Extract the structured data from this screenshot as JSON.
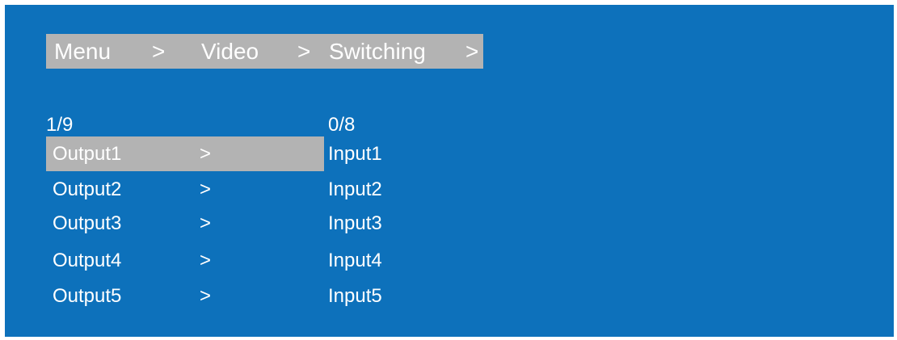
{
  "breadcrumb": {
    "menu": "Menu",
    "sep1": ">",
    "video": "Video",
    "sep2": ">",
    "switching": "Switching",
    "sep3": ">"
  },
  "outputs_page": "1/9",
  "inputs_page": "0/8",
  "rows": [
    {
      "output": "Output1",
      "arrow": ">",
      "input": "Input1",
      "selected": true
    },
    {
      "output": "Output2",
      "arrow": ">",
      "input": "Input2",
      "selected": false
    },
    {
      "output": "Output3",
      "arrow": ">",
      "input": "Input3",
      "selected": false
    },
    {
      "output": "Output4",
      "arrow": ">",
      "input": "Input4",
      "selected": false
    },
    {
      "output": "Output5",
      "arrow": ">",
      "input": "Input5",
      "selected": false
    }
  ],
  "colors": {
    "background": "#0d71bb",
    "highlight": "#b3b3b3",
    "text": "#ffffff"
  }
}
